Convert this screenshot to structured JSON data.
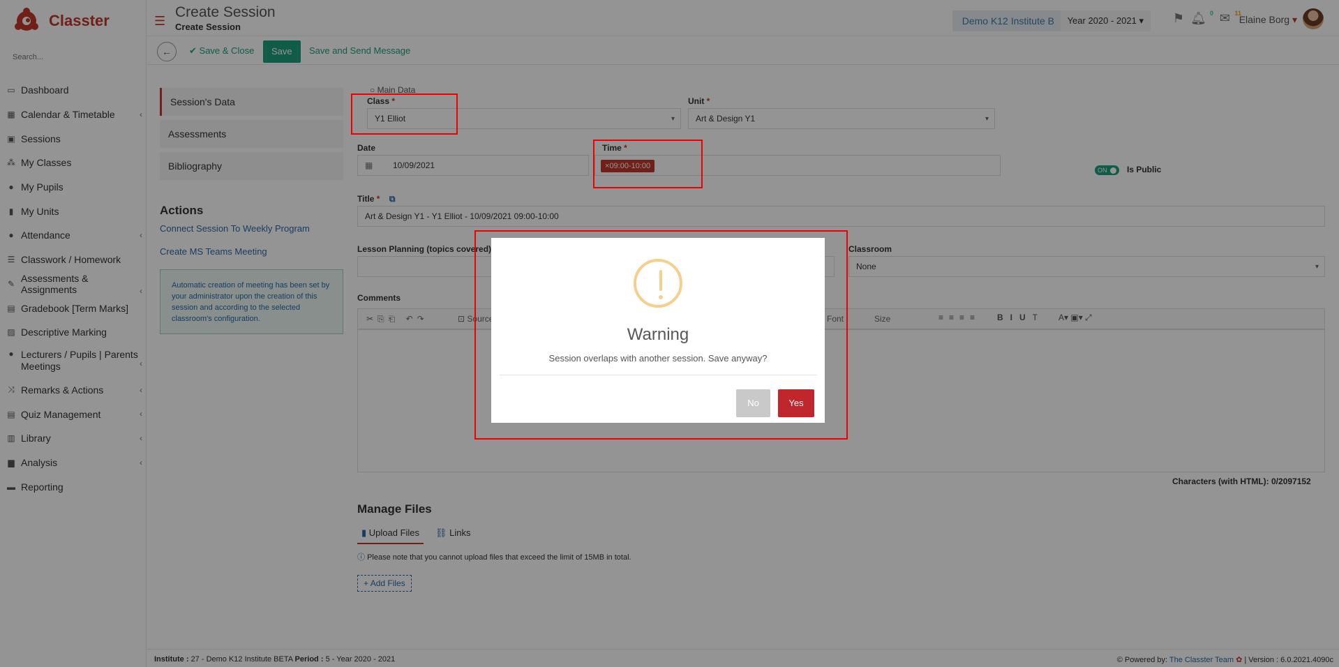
{
  "app": {
    "name": "Classter"
  },
  "search": {
    "placeholder": "Search..."
  },
  "sidebar": {
    "items": [
      {
        "label": "Dashboard",
        "icon": "laptop-icon",
        "chevron": false
      },
      {
        "label": "Calendar & Timetable",
        "icon": "calendar-icon",
        "chevron": true
      },
      {
        "label": "Sessions",
        "icon": "sessions-icon",
        "chevron": false
      },
      {
        "label": "My Classes",
        "icon": "classes-icon",
        "chevron": false
      },
      {
        "label": "My Pupils",
        "icon": "pupils-icon",
        "chevron": false
      },
      {
        "label": "My Units",
        "icon": "book-icon",
        "chevron": false
      },
      {
        "label": "Attendance",
        "icon": "attendance-icon",
        "chevron": true
      },
      {
        "label": "Classwork / Homework",
        "icon": "list-icon",
        "chevron": false
      },
      {
        "label": "Assessments & Assignments",
        "icon": "edit-icon",
        "chevron": true
      },
      {
        "label": "Gradebook [Term Marks]",
        "icon": "gradebook-icon",
        "chevron": false
      },
      {
        "label": "Descriptive Marking",
        "icon": "marking-icon",
        "chevron": false
      },
      {
        "label": "Lecturers / Pupils | Parents Meetings",
        "icon": "meetings-icon",
        "chevron": true
      },
      {
        "label": "Remarks & Actions",
        "icon": "remarks-icon",
        "chevron": true
      },
      {
        "label": "Quiz Management",
        "icon": "quiz-icon",
        "chevron": true
      },
      {
        "label": "Library",
        "icon": "library-icon",
        "chevron": true
      },
      {
        "label": "Analysis",
        "icon": "chart-icon",
        "chevron": true
      },
      {
        "label": "Reporting",
        "icon": "print-icon",
        "chevron": false
      }
    ]
  },
  "header": {
    "title": "Create Session",
    "subtitle": "Create Session",
    "institute": "Demo K12 Institute B",
    "year": "Year 2020 - 2021",
    "bell_count": "0",
    "mail_count": "11",
    "user": "Elaine Borg"
  },
  "toolbar": {
    "save_close": "Save & Close",
    "save": "Save",
    "save_send": "Save and Send Message"
  },
  "left_tabs": [
    "Session's Data",
    "Assessments",
    "Bibliography"
  ],
  "actions": {
    "title": "Actions",
    "link1": "Connect Session To Weekly Program",
    "link2": "Create MS Teams Meeting",
    "note": "Automatic creation of meeting has been set by your administrator upon the creation of this session and according to the selected classroom's configuration."
  },
  "form": {
    "main_data": "Main Data",
    "class_label": "Class",
    "class_value": "Y1 Elliot",
    "unit_label": "Unit",
    "unit_value": "Art & Design Y1",
    "date_label": "Date",
    "date_value": "10/09/2021",
    "time_label": "Time",
    "time_value": "09:00-10:00",
    "toggle_on": "ON",
    "is_public": "Is Public",
    "title_label": "Title",
    "title_value": "Art & Design Y1 - Y1 Elliot - 10/09/2021 09:00-10:00",
    "lesson_label": "Lesson Planning (topics covered)",
    "classroom_label": "Classroom",
    "classroom_value": "None",
    "comments_label": "Comments",
    "source": "Source",
    "font": "Font",
    "size": "Size",
    "char_count": "Characters (with HTML): 0/2097152"
  },
  "files": {
    "title": "Manage Files",
    "tab_upload": "Upload Files",
    "tab_links": "Links",
    "note": "Please note that you cannot upload files that exceed the limit of 15MB in total.",
    "add": "Add Files"
  },
  "footer": {
    "left_inst_label": "Institute :",
    "left_inst": "27 - Demo K12 Institute BETA",
    "left_period_label": "Period :",
    "left_period": "5 - Year 2020 - 2021",
    "powered": "Powered by:",
    "team": "The Classter Team",
    "version": "| Version : 6.0.2021.4090c"
  },
  "modal": {
    "title": "Warning",
    "text": "Session overlaps with another session. Save anyway?",
    "no": "No",
    "yes": "Yes"
  },
  "colors": {
    "brand": "#c0392b",
    "accent": "#1e9e7e",
    "link": "#2a6aa5",
    "warning": "#f6cf8f"
  }
}
